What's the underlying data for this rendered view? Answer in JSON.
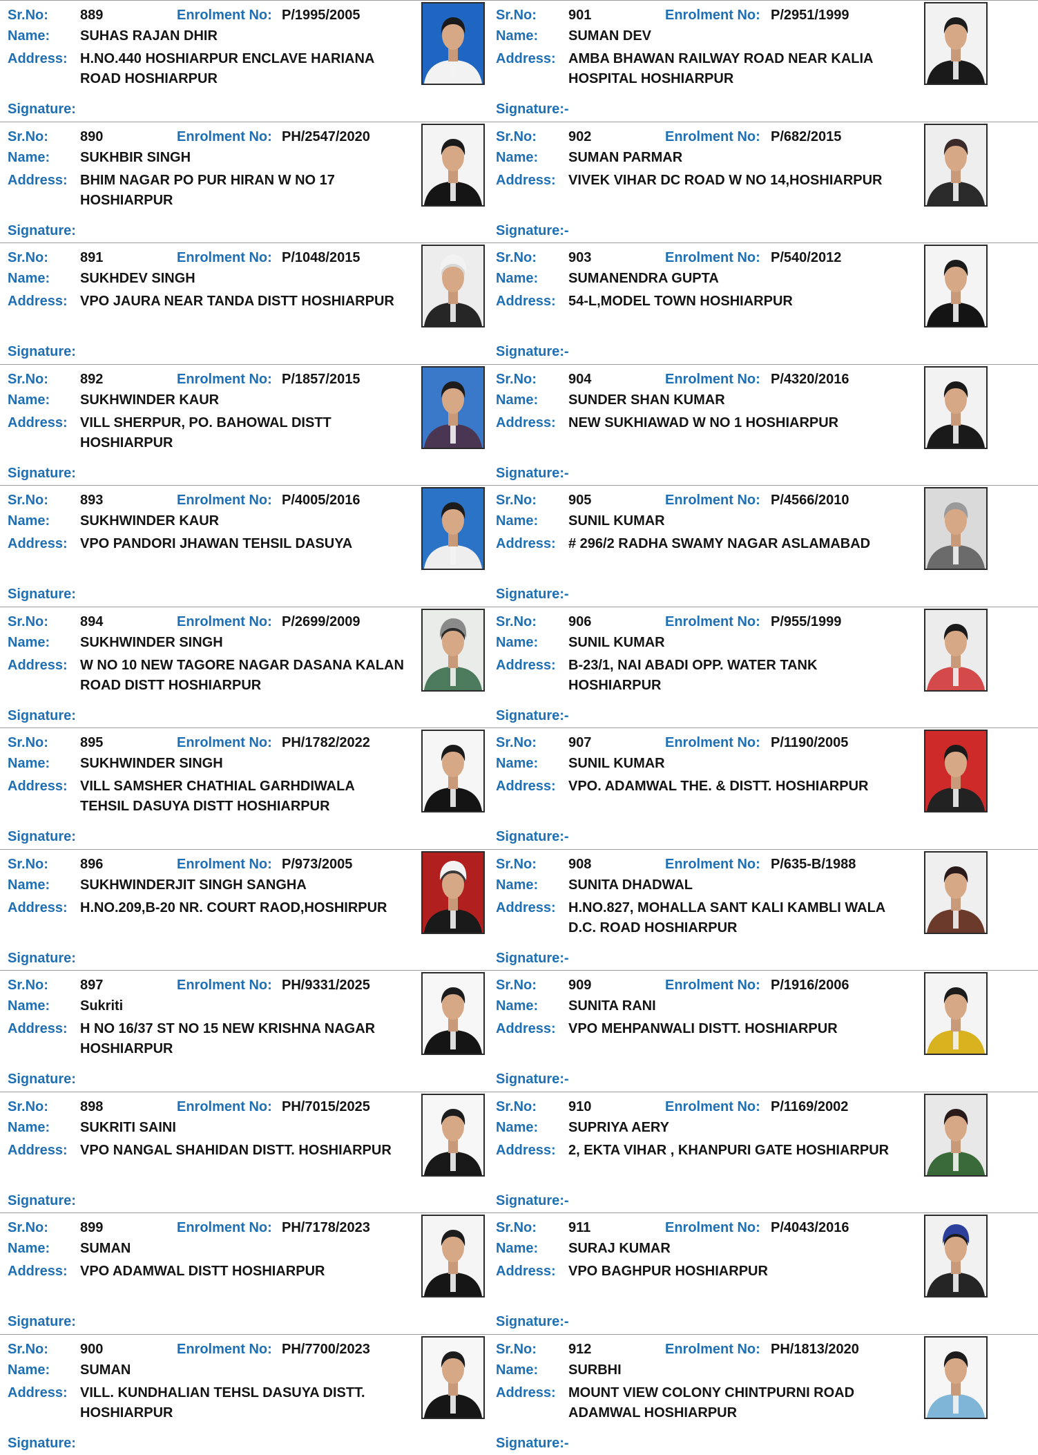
{
  "labels": {
    "sr_no": "Sr.No:",
    "enrolment_no": "Enrolment No:",
    "name": "Name:",
    "address": "Address:",
    "signature_left": "Signature:",
    "signature_right": "Signature:-"
  },
  "records": [
    {
      "sr_no": "889",
      "enrolment_no": "P/1995/2005",
      "name": "SUHAS RAJAN DHIR",
      "address": "H.NO.440 HOSHIARPUR ENCLAVE HARIANA ROAD HOSHIARPUR",
      "photo": {
        "bg": "#1f66c2",
        "attire": "#f2f2f2",
        "hair": "#1a1a1a",
        "turban": ""
      }
    },
    {
      "sr_no": "890",
      "enrolment_no": "PH/2547/2020",
      "name": "SUKHBIR SINGH",
      "address": "BHIM NAGAR PO PUR HIRAN W NO 17 HOSHIARPUR",
      "photo": {
        "bg": "#f4f4f4",
        "attire": "#151515",
        "hair": "#1a1a1a",
        "turban": ""
      }
    },
    {
      "sr_no": "891",
      "enrolment_no": "P/1048/2015",
      "name": "SUKHDEV SINGH",
      "address": "VPO JAURA NEAR TANDA DISTT HOSHIARPUR",
      "photo": {
        "bg": "#ededed",
        "attire": "#262626",
        "hair": "#d8d8d8",
        "turban": "#f2f2f2"
      }
    },
    {
      "sr_no": "892",
      "enrolment_no": "P/1857/2015",
      "name": "SUKHWINDER KAUR",
      "address": "VILL SHERPUR, PO. BAHOWAL DISTT HOSHIARPUR",
      "photo": {
        "bg": "#3a79c9",
        "attire": "#4a3552",
        "hair": "#1c1c1c",
        "turban": ""
      }
    },
    {
      "sr_no": "893",
      "enrolment_no": "P/4005/2016",
      "name": "SUKHWINDER KAUR",
      "address": "VPO PANDORI JHAWAN TEHSIL DASUYA",
      "photo": {
        "bg": "#2b73c6",
        "attire": "#eeeeee",
        "hair": "#1c1c1c",
        "turban": ""
      }
    },
    {
      "sr_no": "894",
      "enrolment_no": "P/2699/2009",
      "name": "SUKHWINDER SINGH",
      "address": "W NO 10 NEW TAGORE NAGAR DASANA KALAN ROAD DISTT HOSHIARPUR",
      "photo": {
        "bg": "#e9ece8",
        "attire": "#4c7a5c",
        "hair": "#2a2a2a",
        "turban": "#8a8a8a"
      }
    },
    {
      "sr_no": "895",
      "enrolment_no": "PH/1782/2022",
      "name": "SUKHWINDER SINGH",
      "address": "VILL SAMSHER CHATHIAL GARHDIWALA TEHSIL DASUYA DISTT HOSHIARPUR",
      "photo": {
        "bg": "#f6f6f6",
        "attire": "#141414",
        "hair": "#1a1a1a",
        "turban": ""
      }
    },
    {
      "sr_no": "896",
      "enrolment_no": "P/973/2005",
      "name": "SUKHWINDERJIT SINGH SANGHA",
      "address": "H.NO.209,B-20 NR. COURT RAOD,HOSHIRPUR",
      "photo": {
        "bg": "#b11f1f",
        "attire": "#1a1a1a",
        "hair": "#3a3a3a",
        "turban": "#f3f3f3"
      }
    },
    {
      "sr_no": "897",
      "enrolment_no": "PH/9331/2025",
      "name": "Sukriti",
      "address": "H NO 16/37 ST NO 15 NEW KRISHNA NAGAR HOSHIARPUR",
      "photo": {
        "bg": "#f7f7f7",
        "attire": "#151515",
        "hair": "#1c1c1c",
        "turban": ""
      }
    },
    {
      "sr_no": "898",
      "enrolment_no": "PH/7015/2025",
      "name": "SUKRITI SAINI",
      "address": "VPO NANGAL SHAHIDAN DISTT. HOSHIARPUR",
      "photo": {
        "bg": "#f7f7f7",
        "attire": "#181818",
        "hair": "#1c1c1c",
        "turban": ""
      }
    },
    {
      "sr_no": "899",
      "enrolment_no": "PH/7178/2023",
      "name": "SUMAN",
      "address": "VPO ADAMWAL DISTT HOSHIARPUR",
      "photo": {
        "bg": "#f5f5f5",
        "attire": "#161616",
        "hair": "#1c1c1c",
        "turban": ""
      }
    },
    {
      "sr_no": "900",
      "enrolment_no": "PH/7700/2023",
      "name": "SUMAN",
      "address": "VILL. KUNDHALIAN TEHSL DASUYA DISTT. HOSHIARPUR",
      "photo": {
        "bg": "#f7f7f7",
        "attire": "#161616",
        "hair": "#1c1c1c",
        "turban": ""
      }
    },
    {
      "sr_no": "901",
      "enrolment_no": "P/2951/1999",
      "name": "SUMAN DEV",
      "address": "AMBA BHAWAN RAILWAY ROAD NEAR KALIA HOSPITAL HOSHIARPUR",
      "photo": {
        "bg": "#f2f2f2",
        "attire": "#1a1a1a",
        "hair": "#1c1c1c",
        "turban": ""
      }
    },
    {
      "sr_no": "902",
      "enrolment_no": "P/682/2015",
      "name": "SUMAN PARMAR",
      "address": "VIVEK VIHAR DC ROAD W NO 14,HOSHIARPUR",
      "photo": {
        "bg": "#eeeeee",
        "attire": "#2a2a2a",
        "hair": "#3a2a2a",
        "turban": ""
      }
    },
    {
      "sr_no": "903",
      "enrolment_no": "P/540/2012",
      "name": "SUMANENDRA GUPTA",
      "address": "54-L,MODEL TOWN HOSHIARPUR",
      "photo": {
        "bg": "#f4f4f4",
        "attire": "#141414",
        "hair": "#1a1a1a",
        "turban": ""
      }
    },
    {
      "sr_no": "904",
      "enrolment_no": "P/4320/2016",
      "name": "SUNDER SHAN KUMAR",
      "address": "NEW SUKHIAWAD W NO 1 HOSHIARPUR",
      "photo": {
        "bg": "#f2f2f2",
        "attire": "#1a1a1a",
        "hair": "#1a1a1a",
        "turban": ""
      }
    },
    {
      "sr_no": "905",
      "enrolment_no": "P/4566/2010",
      "name": "SUNIL KUMAR",
      "address": "# 296/2 RADHA SWAMY NAGAR ASLAMABAD",
      "photo": {
        "bg": "#dadada",
        "attire": "#6b6b6b",
        "hair": "#9a9a9a",
        "turban": ""
      }
    },
    {
      "sr_no": "906",
      "enrolment_no": "P/955/1999",
      "name": "SUNIL KUMAR",
      "address": "B-23/1, NAI ABADI OPP. WATER TANK HOSHIARPUR",
      "photo": {
        "bg": "#ececec",
        "attire": "#d44a4a",
        "hair": "#1a1a1a",
        "turban": ""
      }
    },
    {
      "sr_no": "907",
      "enrolment_no": "P/1190/2005",
      "name": "SUNIL KUMAR",
      "address": "VPO. ADAMWAL THE. & DISTT. HOSHIARPUR",
      "photo": {
        "bg": "#cf2a2a",
        "attire": "#222222",
        "hair": "#1a1a1a",
        "turban": ""
      }
    },
    {
      "sr_no": "908",
      "enrolment_no": "P/635-B/1988",
      "name": "SUNITA DHADWAL",
      "address": "H.NO.827, MOHALLA SANT KALI KAMBLI WALA D.C. ROAD HOSHIARPUR",
      "photo": {
        "bg": "#efefef",
        "attire": "#6b3a2a",
        "hair": "#2a1a1a",
        "turban": ""
      }
    },
    {
      "sr_no": "909",
      "enrolment_no": "P/1916/2006",
      "name": "SUNITA RANI",
      "address": "VPO MEHPANWALI DISTT. HOSHIARPUR",
      "photo": {
        "bg": "#f4f4f4",
        "attire": "#d9b21f",
        "hair": "#1c1c1c",
        "turban": ""
      }
    },
    {
      "sr_no": "910",
      "enrolment_no": "P/1169/2002",
      "name": "SUPRIYA AERY",
      "address": "2, EKTA VIHAR , KHANPURI GATE HOSHIARPUR",
      "photo": {
        "bg": "#e8e8e8",
        "attire": "#3a6a3a",
        "hair": "#2a1a1a",
        "turban": ""
      }
    },
    {
      "sr_no": "911",
      "enrolment_no": "P/4043/2016",
      "name": "SURAJ KUMAR",
      "address": "VPO BAGHPUR HOSHIARPUR",
      "photo": {
        "bg": "#f1f1f1",
        "attire": "#252525",
        "hair": "#1a1a1a",
        "turban": "#2c3f9a"
      }
    },
    {
      "sr_no": "912",
      "enrolment_no": "PH/1813/2020",
      "name": "SURBHI",
      "address": "MOUNT VIEW COLONY CHINTPURNI ROAD ADAMWAL HOSHIARPUR",
      "photo": {
        "bg": "#f6f6f6",
        "attire": "#7fb6d8",
        "hair": "#1c1c1c",
        "turban": ""
      }
    }
  ]
}
